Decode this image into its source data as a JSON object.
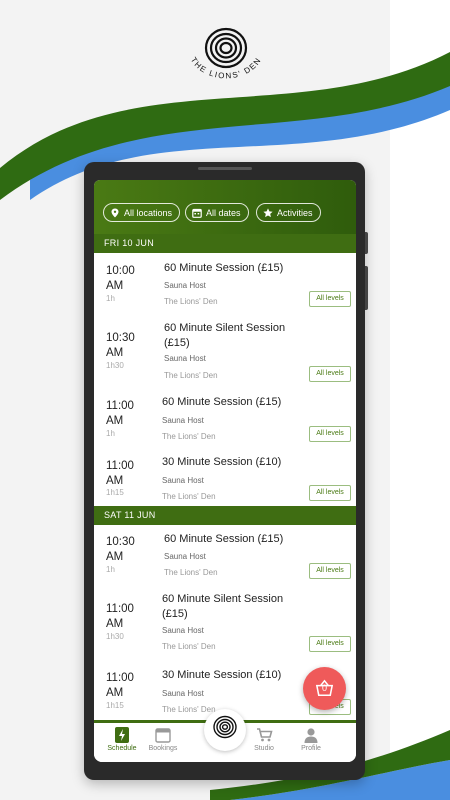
{
  "brand": {
    "name": "THE LIONS' DEN"
  },
  "colors": {
    "green": "#3f6d12",
    "blue": "#4a8ee0",
    "basket": "#ef5a5a"
  },
  "filters": {
    "locations": "All locations",
    "dates": "All dates",
    "activities": "Activities"
  },
  "days": [
    {
      "label": "FRI 10 JUN",
      "sessions": [
        {
          "time": "10:00",
          "ampm": "AM",
          "duration": "1h",
          "title": "60 Minute Session (£15)",
          "host": "Sauna Host",
          "location": "The Lions' Den",
          "level": "All levels"
        },
        {
          "time": "10:30",
          "ampm": "AM",
          "duration": "1h30",
          "title": "60 Minute Silent Session (£15)",
          "host": "Sauna Host",
          "location": "The Lions' Den",
          "level": "All levels"
        },
        {
          "time": "11:00",
          "ampm": "AM",
          "duration": "1h",
          "title": "60 Minute Session (£15)",
          "host": "Sauna Host",
          "location": "The Lions' Den",
          "level": "All levels"
        },
        {
          "time": "11:00",
          "ampm": "AM",
          "duration": "1h15",
          "title": "30 Minute Session (£10)",
          "host": "Sauna Host",
          "location": "The Lions' Den",
          "level": "All levels"
        }
      ]
    },
    {
      "label": "SAT 11 JUN",
      "sessions": [
        {
          "time": "10:30",
          "ampm": "AM",
          "duration": "1h",
          "title": "60 Minute Session (£15)",
          "host": "Sauna Host",
          "location": "The Lions' Den",
          "level": "All levels"
        },
        {
          "time": "11:00",
          "ampm": "AM",
          "duration": "1h30",
          "title": "60 Minute Silent Session (£15)",
          "host": "Sauna Host",
          "location": "The Lions' Den",
          "level": "All levels"
        },
        {
          "time": "11:00",
          "ampm": "AM",
          "duration": "1h15",
          "title": "30 Minute Session (£10)",
          "host": "Sauna Host",
          "location": "The Lions' Den",
          "level": "All levels"
        }
      ]
    }
  ],
  "basket": {
    "count": "0",
    "icon": "basket-icon"
  },
  "tabs": {
    "schedule": "Schedule",
    "bookings": "Bookings",
    "studio": "Studio",
    "profile": "Profile"
  }
}
